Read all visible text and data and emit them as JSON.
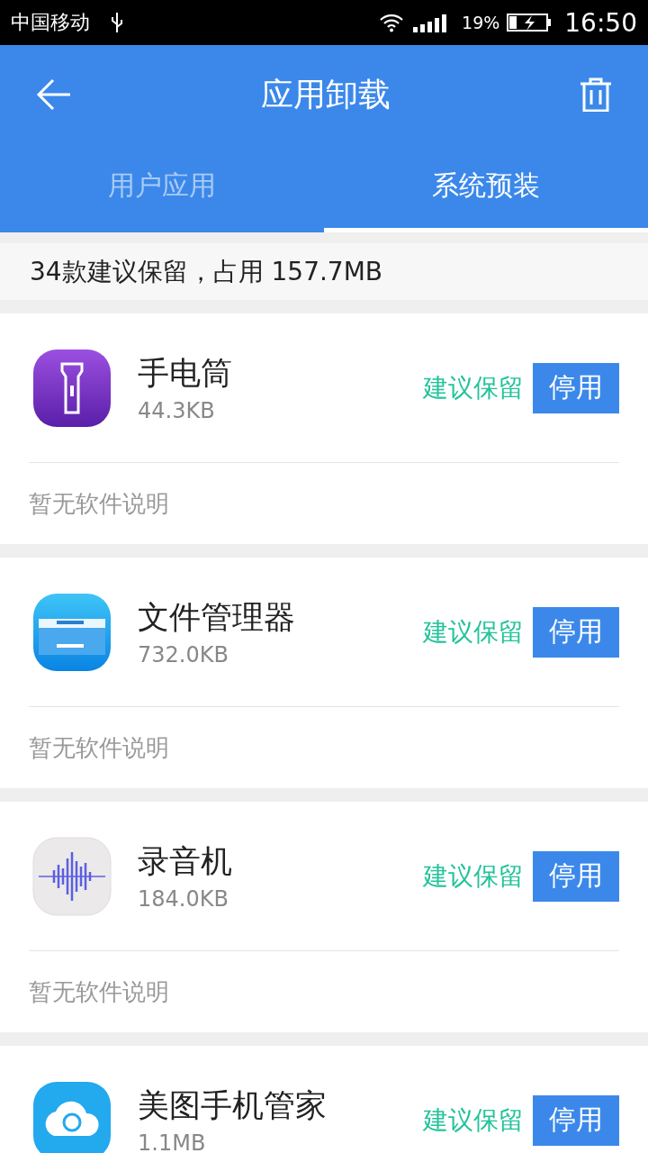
{
  "status_bar": {
    "carrier": "中国移动",
    "battery": "19%",
    "time": "16:50"
  },
  "header": {
    "title": "应用卸载"
  },
  "tabs": [
    {
      "label": "用户应用",
      "selected": false
    },
    {
      "label": "系统预装",
      "selected": true
    }
  ],
  "summary": "34款建议保留，占用 157.7MB",
  "apps": [
    {
      "name": "手电筒",
      "size": "44.3KB",
      "advice": "建议保留",
      "action": "停用",
      "description": "暂无软件说明"
    },
    {
      "name": "文件管理器",
      "size": "732.0KB",
      "advice": "建议保留",
      "action": "停用",
      "description": "暂无软件说明"
    },
    {
      "name": "录音机",
      "size": "184.0KB",
      "advice": "建议保留",
      "action": "停用",
      "description": "暂无软件说明"
    },
    {
      "name": "美图手机管家",
      "size": "1.1MB",
      "advice": "建议保留",
      "action": "停用"
    }
  ]
}
